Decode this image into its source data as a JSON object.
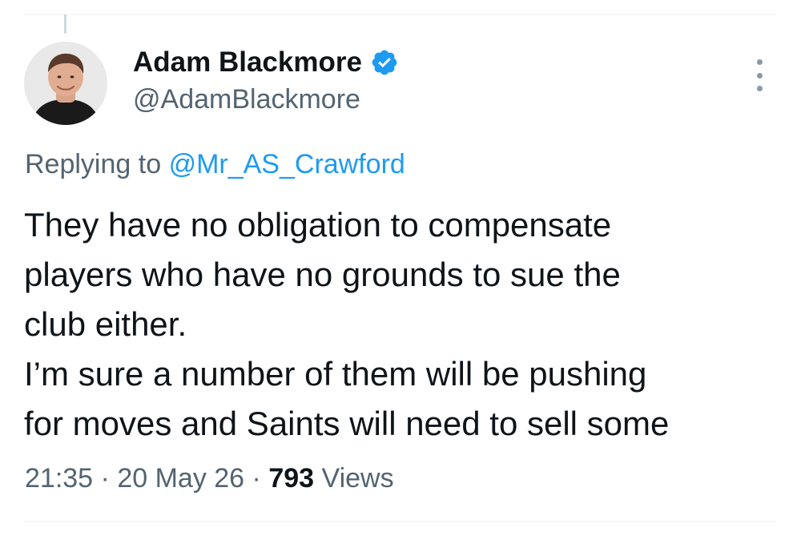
{
  "author": {
    "display_name": "Adam Blackmore",
    "handle": "@AdamBlackmore",
    "verified": true,
    "verified_icon": "verified-badge-icon",
    "avatar": "profile-photo"
  },
  "reply": {
    "prefix": "Replying to",
    "mention": "@Mr_AS_Crawford"
  },
  "tweet": {
    "lines": [
      "They have no obligation to compensate",
      "players who have no grounds to sue the",
      "club either.",
      "I’m sure a number of them will be pushing",
      "for moves and Saints will need to sell some"
    ]
  },
  "meta": {
    "time": "21:35",
    "separator": "·",
    "date": "20 May 26",
    "views_count": "793",
    "views_label": "Views"
  },
  "icons": {
    "more": "more-vertical-icon"
  },
  "colors": {
    "accent": "#1d9bf0",
    "secondary_text": "#536471",
    "primary_text": "#0f1419",
    "divider": "#eff3f4"
  }
}
